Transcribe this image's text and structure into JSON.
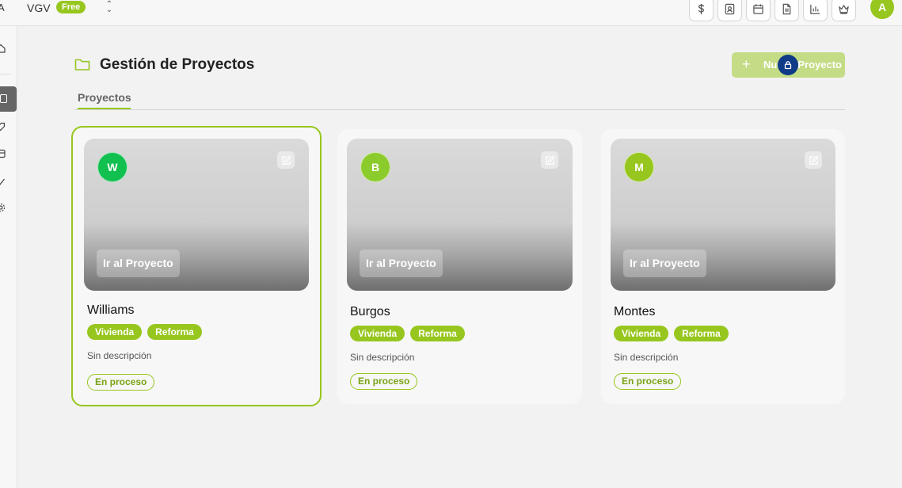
{
  "topbar": {
    "logo_fragment": "A",
    "workspace_name": "VGV",
    "plan_badge": "Free",
    "icons": [
      "dollar-icon",
      "contact-card-icon",
      "calendar-icon",
      "document-icon",
      "bar-chart-icon",
      "crown-icon"
    ],
    "user_initial": "A"
  },
  "header": {
    "title": "Gestión de Proyectos",
    "new_button_label": "Nuevo Proyecto"
  },
  "tabs": [
    {
      "label": "Proyectos",
      "active": true
    }
  ],
  "colors": {
    "accent": "#97c61f",
    "lock_badge": "#0f3b87",
    "avatar_williams": "#11c04f",
    "avatar_burgos": "#8ccb2c",
    "avatar_montes": "#97c61f"
  },
  "projects": [
    {
      "initial": "W",
      "go_label": "Ir al Proyecto",
      "name": "Williams",
      "tags": [
        "Vivienda",
        "Reforma"
      ],
      "description": "Sin descripción",
      "status": "En proceso",
      "selected": true
    },
    {
      "initial": "B",
      "go_label": "Ir al Proyecto",
      "name": "Burgos",
      "tags": [
        "Vivienda",
        "Reforma"
      ],
      "description": "Sin descripción",
      "status": "En proceso",
      "selected": false
    },
    {
      "initial": "M",
      "go_label": "Ir al Proyecto",
      "name": "Montes",
      "tags": [
        "Vivienda",
        "Reforma"
      ],
      "description": "Sin descripción",
      "status": "En proceso",
      "selected": false
    }
  ]
}
